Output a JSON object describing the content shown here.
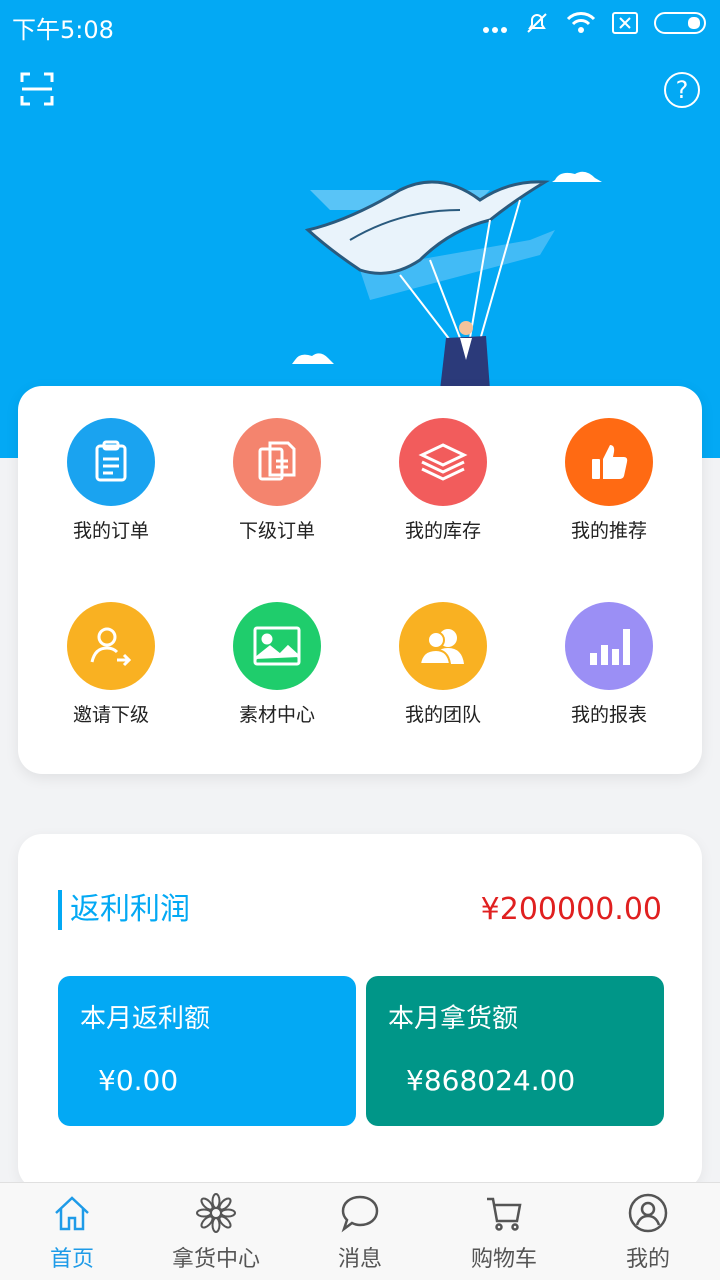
{
  "status_bar": {
    "time": "下午5:08"
  },
  "menu": [
    {
      "label": "我的订单",
      "icon": "clipboard-icon",
      "color": "#1aa3f0"
    },
    {
      "label": "下级订单",
      "icon": "documents-icon",
      "color": "#f4846e"
    },
    {
      "label": "我的库存",
      "icon": "layers-icon",
      "color": "#f25c5c"
    },
    {
      "label": "我的推荐",
      "icon": "thumbs-up-icon",
      "color": "#ff6a13"
    },
    {
      "label": "邀请下级",
      "icon": "invite-user-icon",
      "color": "#f9b122"
    },
    {
      "label": "素材中心",
      "icon": "image-icon",
      "color": "#1fcd6c"
    },
    {
      "label": "我的团队",
      "icon": "team-icon",
      "color": "#f9b122"
    },
    {
      "label": "我的报表",
      "icon": "bar-chart-icon",
      "color": "#9b8ff5"
    }
  ],
  "profit": {
    "title": "返利利润",
    "total": "¥200000.00",
    "monthly_rebate": {
      "label": "本月返利额",
      "value": "¥0.00",
      "color": "#03a9f4"
    },
    "monthly_purchase": {
      "label": "本月拿货额",
      "value": "¥868024.00",
      "color": "#009688"
    }
  },
  "tabs": [
    {
      "label": "首页",
      "icon": "home-icon",
      "active": true
    },
    {
      "label": "拿货中心",
      "icon": "flower-icon",
      "active": false
    },
    {
      "label": "消息",
      "icon": "chat-icon",
      "active": false
    },
    {
      "label": "购物车",
      "icon": "cart-icon",
      "active": false
    },
    {
      "label": "我的",
      "icon": "user-icon",
      "active": false
    }
  ]
}
